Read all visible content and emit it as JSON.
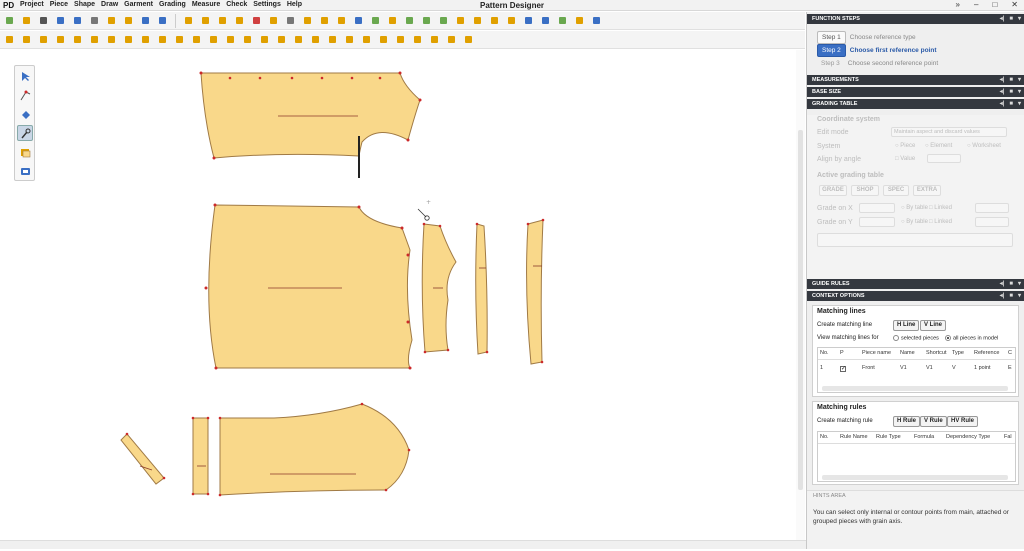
{
  "app": {
    "logo": "PD",
    "title": "Pattern Designer"
  },
  "menu": [
    "Project",
    "Piece",
    "Shape",
    "Draw",
    "Garment",
    "Grading",
    "Measure",
    "Check",
    "Settings",
    "Help"
  ],
  "window_controls": {
    "collapse": "»",
    "minimize": "–",
    "maximize": "□",
    "close": "✕"
  },
  "panel": {
    "function_steps": {
      "header": "FUNCTION STEPS",
      "steps": [
        {
          "label": "Step 1",
          "text": "Choose reference type"
        },
        {
          "label": "Step 2",
          "text": "Choose first reference point"
        },
        {
          "label": "Step 3",
          "text": "Choose second reference point"
        }
      ]
    },
    "measurements_header": "MEASUREMENTS",
    "base_size_header": "BASE SIZE",
    "grading_table": {
      "header": "GRADING TABLE",
      "coordinate_system": "Coordinate system",
      "edit_mode": "Edit mode",
      "edit_mode_value": "Maintain aspect and discard values",
      "system": "System",
      "system_options": [
        "Piece",
        "Element",
        "Worksheet"
      ],
      "align_by_angle": "Align by angle",
      "value": "Value",
      "active_grading_table": "Active grading table",
      "tabs": [
        "GRADE",
        "SHOP",
        "SPEC",
        "EXTRA"
      ],
      "grade_on_x": "Grade on X",
      "grade_on_y": "Grade on Y",
      "by_table": "By table",
      "linked": "Linked"
    },
    "guide_rules_header": "GUIDE RULES",
    "context_options": {
      "header": "CONTEXT OPTIONS",
      "matching_lines": {
        "title": "Matching lines",
        "create_label": "Create matching line",
        "h_line": "H Line",
        "v_line": "V Line",
        "view_label": "View matching lines for",
        "opt_selected": "selected pieces",
        "opt_all": "all pieces in model",
        "columns": [
          "No.",
          "P",
          "Piece name",
          "Name",
          "Shortcut",
          "Type",
          "Reference",
          "C"
        ],
        "rows": [
          {
            "no": "1",
            "piece": "Front",
            "name": "V1",
            "shortcut": "V1",
            "type": "V",
            "reference": "1 point",
            "c": "E"
          }
        ]
      },
      "matching_rules": {
        "title": "Matching rules",
        "create_label": "Create matching rule",
        "h_rule": "H Rule",
        "v_rule": "V Rule",
        "hv_rule": "HV Rule",
        "columns": [
          "No.",
          "Rule Name",
          "Rule Type",
          "Formula",
          "Dependency Type",
          "Fal"
        ]
      }
    },
    "hints": {
      "header": "HINTS AREA",
      "text": "You can select only internal or contour points from main, attached or grouped pieces with grain axis."
    }
  },
  "colors": {
    "piece_fill": "#f9d88a",
    "piece_stroke": "#a07a45",
    "notch": "#cc2a2a",
    "panel_dark": "#34383f",
    "accent": "#3a6fc4"
  },
  "palette_tools": [
    "select-arrow-icon",
    "point-tool-icon",
    "fill-tool-icon",
    "pin-tool-icon",
    "piece-tool-icon",
    "layers-tool-icon"
  ]
}
